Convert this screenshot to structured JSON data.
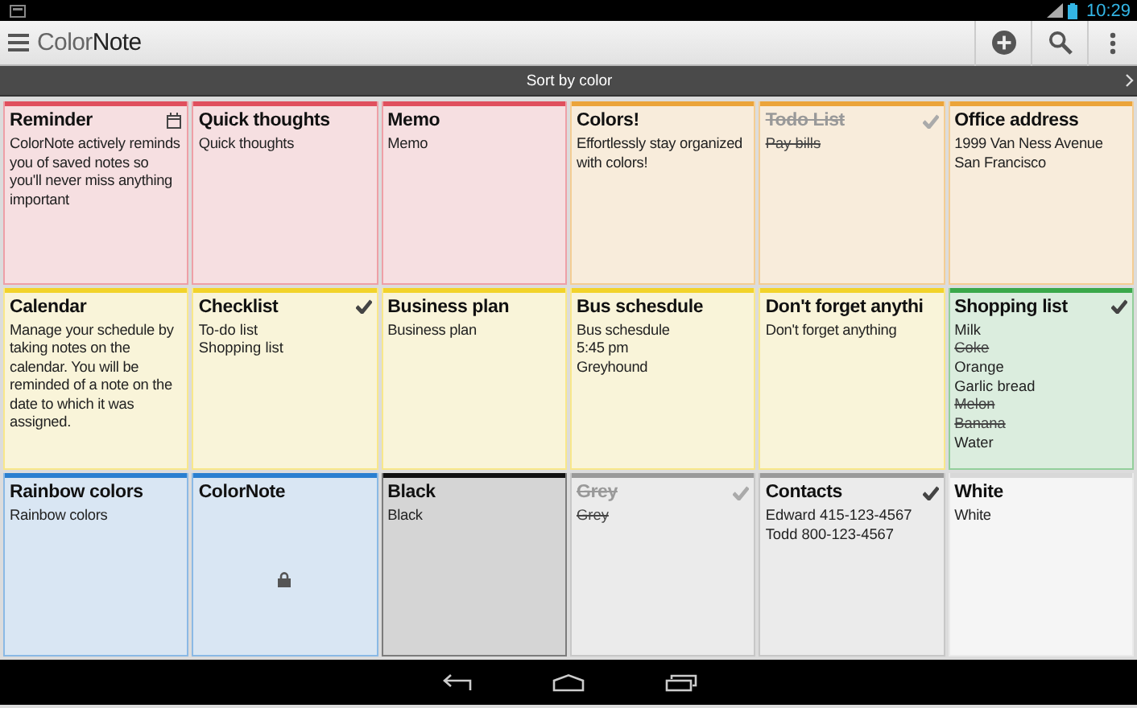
{
  "status_bar": {
    "time": "10:29"
  },
  "app_bar": {
    "title": "Color**Note**"
  },
  "sort_bar": {
    "label": "Sort by color"
  },
  "notes": [
    {
      "title": "Reminder",
      "color": "#e0505e",
      "reminder": true,
      "checklist": false,
      "completed": false,
      "locked": false,
      "text": "ColorNote actively reminds you of saved notes so you'll never miss anything important"
    },
    {
      "title": "Quick thoughts",
      "color": "#e0505e",
      "reminder": false,
      "checklist": false,
      "completed": false,
      "locked": false,
      "text": "Quick thoughts"
    },
    {
      "title": "Memo",
      "color": "#e0505e",
      "reminder": false,
      "checklist": false,
      "completed": false,
      "locked": false,
      "text": "Memo"
    },
    {
      "title": "Colors!",
      "color": "#eba43a",
      "reminder": false,
      "checklist": false,
      "completed": false,
      "locked": false,
      "text": "Effortlessly stay organized with colors!"
    },
    {
      "title": "Todo List",
      "color": "#eba43a",
      "reminder": false,
      "checklist": true,
      "completed": true,
      "locked": false,
      "items": [
        {
          "text": "Pay bills",
          "checked": true
        }
      ]
    },
    {
      "title": "Office address",
      "color": "#eba43a",
      "reminder": false,
      "checklist": false,
      "completed": false,
      "locked": false,
      "text": "1999 Van Ness Avenue\nSan Francisco"
    },
    {
      "title": "Calendar",
      "color": "#f2d32a",
      "reminder": false,
      "checklist": false,
      "completed": false,
      "locked": false,
      "text": "Manage your schedule by taking notes on the calendar. You will be reminded of a note on the date to which it was assigned."
    },
    {
      "title": "Checklist",
      "color": "#f2d32a",
      "reminder": false,
      "checklist": true,
      "completed": false,
      "locked": false,
      "items": [
        {
          "text": "To-do list",
          "checked": false
        },
        {
          "text": "Shopping list",
          "checked": false
        }
      ]
    },
    {
      "title": "Business plan",
      "color": "#f2d32a",
      "reminder": false,
      "checklist": false,
      "completed": false,
      "locked": false,
      "text": "Business plan"
    },
    {
      "title": "Bus schesdule",
      "color": "#f2d32a",
      "reminder": false,
      "checklist": false,
      "completed": false,
      "locked": false,
      "text": "Bus schesdule\n5:45 pm\nGreyhound"
    },
    {
      "title": "Don't forget anythi",
      "color": "#f2d32a",
      "reminder": false,
      "checklist": false,
      "completed": false,
      "locked": false,
      "text": "Don't forget anything"
    },
    {
      "title": "Shopping list",
      "color": "#3aa84a",
      "reminder": false,
      "checklist": true,
      "completed": false,
      "locked": false,
      "items": [
        {
          "text": "Milk",
          "checked": false
        },
        {
          "text": "Coke",
          "checked": true
        },
        {
          "text": "Orange",
          "checked": false
        },
        {
          "text": "Garlic bread",
          "checked": false
        },
        {
          "text": "Melon",
          "checked": true
        },
        {
          "text": "Banana",
          "checked": true
        },
        {
          "text": "Water",
          "checked": false
        }
      ]
    },
    {
      "title": "Rainbow colors",
      "color": "#2a7fd0",
      "reminder": false,
      "checklist": false,
      "completed": false,
      "locked": false,
      "text": "Rainbow colors"
    },
    {
      "title": "ColorNote",
      "color": "#2a7fd0",
      "reminder": false,
      "checklist": false,
      "completed": false,
      "locked": true
    },
    {
      "title": "Black",
      "color": "#111111",
      "reminder": false,
      "checklist": false,
      "completed": false,
      "locked": false,
      "text": "Black"
    },
    {
      "title": "Grey",
      "color": "#9a9a9a",
      "reminder": false,
      "checklist": true,
      "completed": true,
      "locked": false,
      "items": [
        {
          "text": "Grey",
          "checked": true
        }
      ]
    },
    {
      "title": "Contacts",
      "color": "#9a9a9a",
      "reminder": false,
      "checklist": true,
      "completed": false,
      "locked": false,
      "items": [
        {
          "text": "Edward 415-123-4567",
          "checked": false
        },
        {
          "text": "Todd 800-123-4567",
          "checked": false
        }
      ]
    },
    {
      "title": "White",
      "color": "#d8d8d8",
      "reminder": false,
      "checklist": false,
      "completed": false,
      "locked": false,
      "text": "White"
    }
  ]
}
